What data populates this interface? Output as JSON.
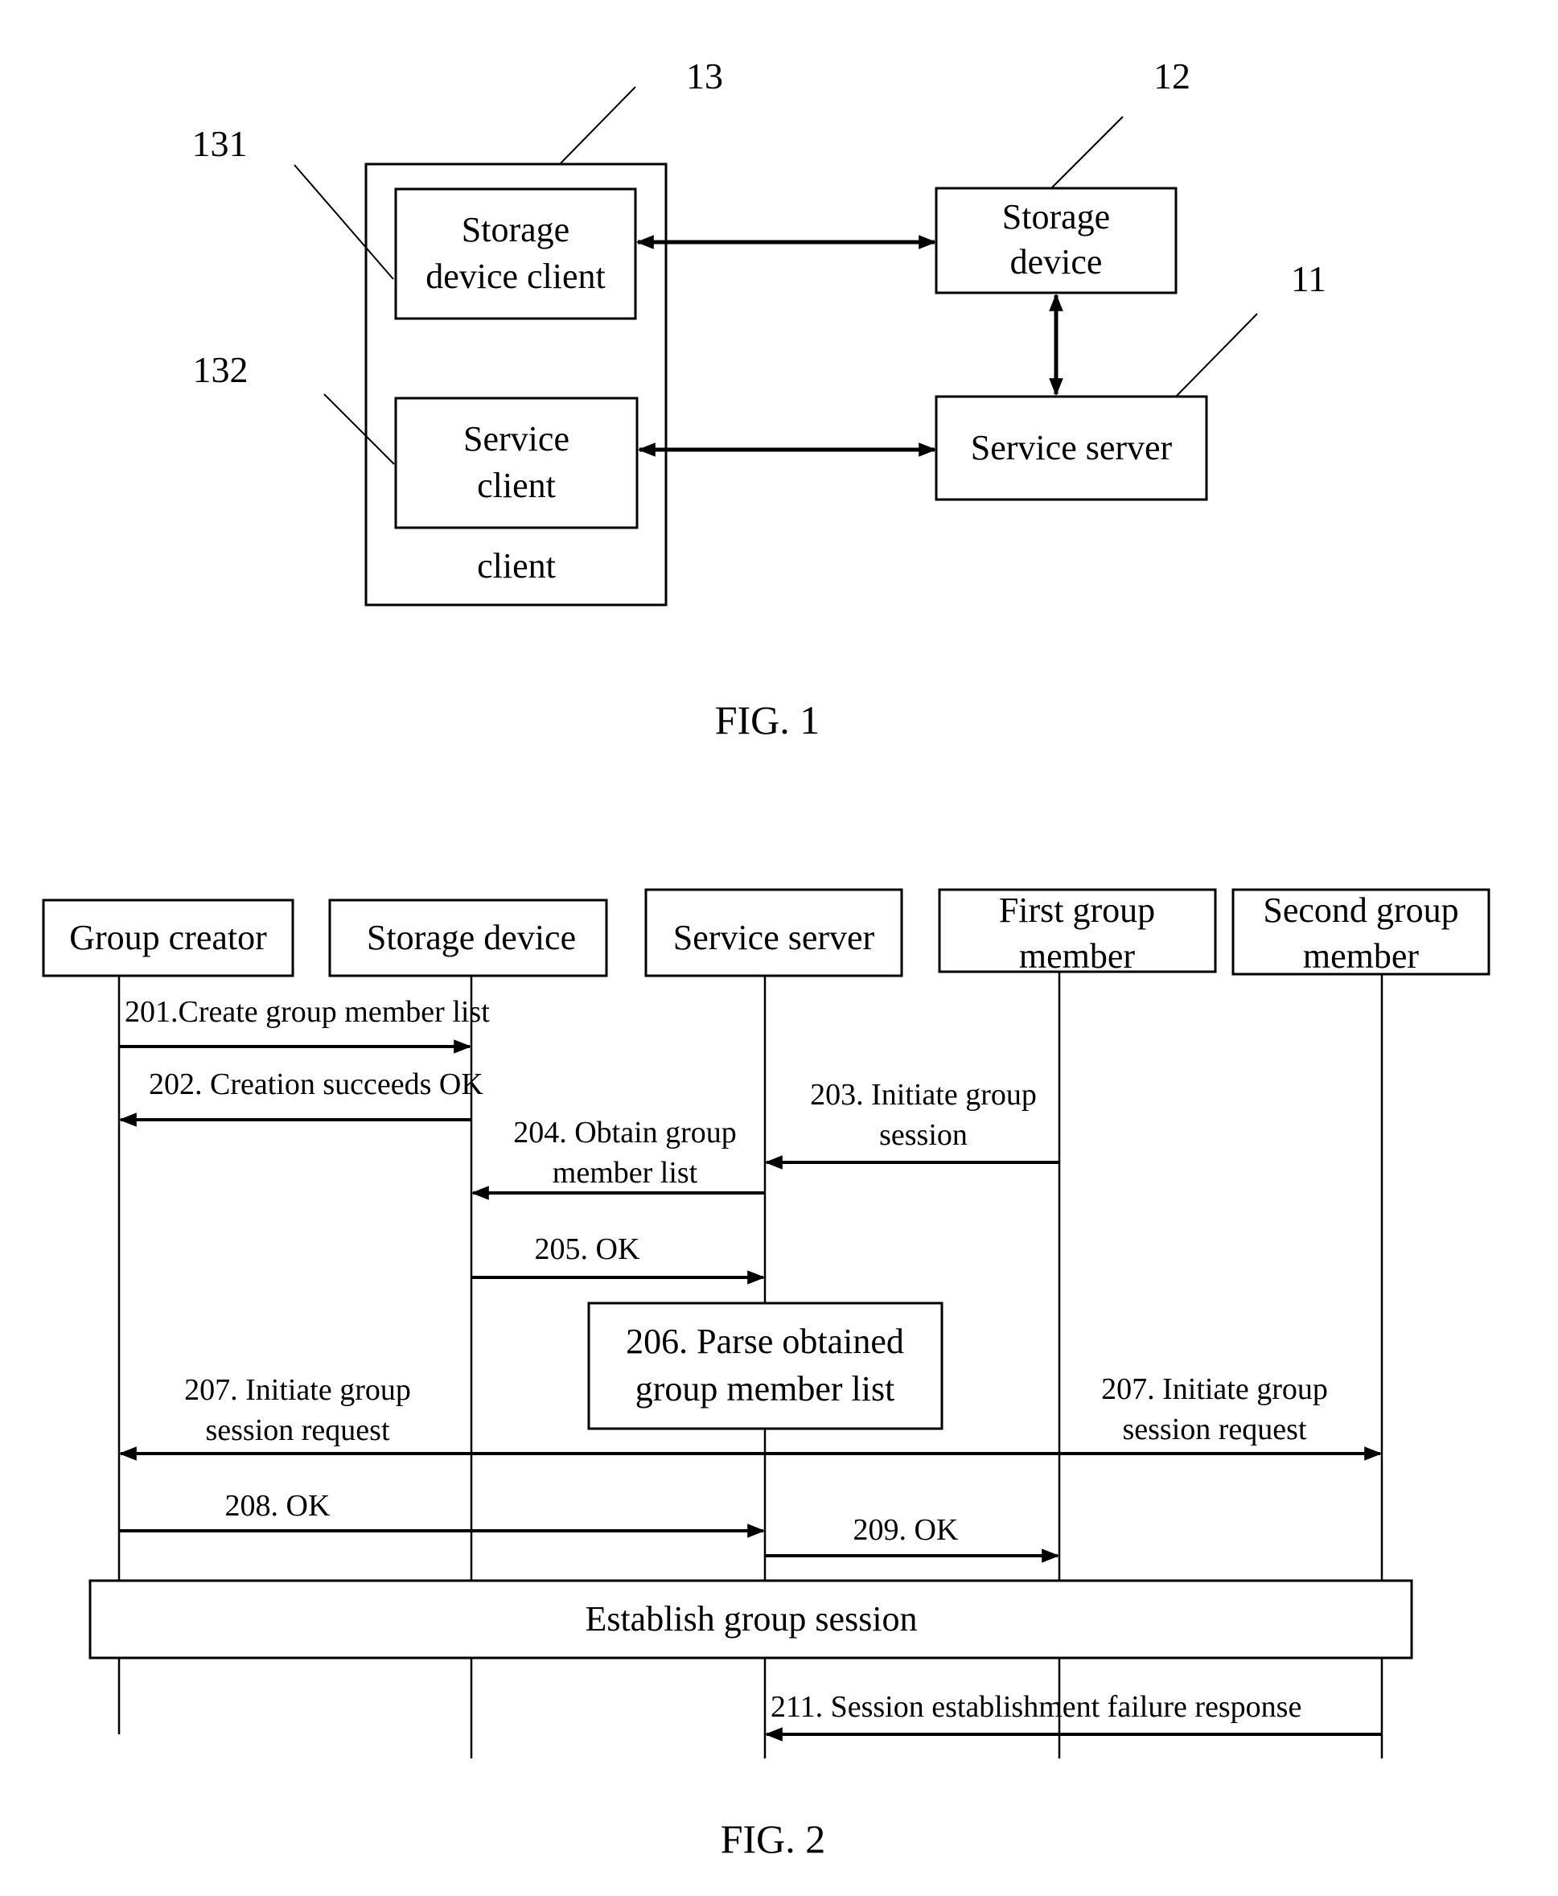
{
  "fig1": {
    "caption": "FIG. 1",
    "ref_labels": {
      "client_outer": "13",
      "storage_device": "12",
      "service_server": "11",
      "storage_device_client": "131",
      "service_client": "132"
    },
    "client_box": {
      "label": "client"
    },
    "storage_device_client": {
      "line1": "Storage",
      "line2": "device client"
    },
    "service_client": {
      "line1": "Service",
      "line2": "client"
    },
    "storage_device": {
      "line1": "Storage",
      "line2": "device"
    },
    "service_server": {
      "label": "Service server"
    },
    "connections": [
      {
        "from": "storage_device_client",
        "to": "storage_device",
        "type": "bidirectional"
      },
      {
        "from": "storage_device",
        "to": "service_server",
        "type": "bidirectional"
      },
      {
        "from": "service_client",
        "to": "service_server",
        "type": "bidirectional"
      }
    ]
  },
  "fig2": {
    "caption": "FIG. 2",
    "participants": [
      {
        "id": "group_creator",
        "line1": "Group creator",
        "line2": ""
      },
      {
        "id": "storage_device",
        "line1": "Storage device",
        "line2": ""
      },
      {
        "id": "service_server",
        "line1": "Service server",
        "line2": ""
      },
      {
        "id": "first_member",
        "line1": "First group",
        "line2": "member"
      },
      {
        "id": "second_member",
        "line1": "Second group",
        "line2": "member"
      }
    ],
    "messages": [
      {
        "step": "201",
        "line1": "201.Create group member list",
        "line2": "",
        "from": "group_creator",
        "to": "storage_device"
      },
      {
        "step": "202",
        "line1": "202. Creation succeeds OK",
        "line2": "",
        "from": "storage_device",
        "to": "group_creator"
      },
      {
        "step": "203",
        "line1": "203. Initiate group",
        "line2": "session",
        "from": "first_member",
        "to": "service_server"
      },
      {
        "step": "204",
        "line1": "204. Obtain group",
        "line2": "member list",
        "from": "service_server",
        "to": "storage_device"
      },
      {
        "step": "205",
        "line1": "205. OK",
        "line2": "",
        "from": "storage_device",
        "to": "service_server"
      },
      {
        "step": "207",
        "line1": "207. Initiate group",
        "line2": "session request",
        "from": "service_server",
        "to": "group_creator / second_member",
        "right_line1": "207. Initiate group",
        "right_line2": "session request"
      },
      {
        "step": "208",
        "line1": "208. OK",
        "line2": "",
        "from": "group_creator",
        "to": "service_server"
      },
      {
        "step": "209",
        "line1": "209. OK",
        "line2": "",
        "from": "service_server",
        "to": "first_member"
      },
      {
        "step": "211",
        "line1": "211. Session establishment failure response",
        "line2": "",
        "from": "second_member",
        "to": "service_server"
      }
    ],
    "process_box": {
      "line1": "206. Parse obtained",
      "line2": "group member list"
    },
    "establish_box": {
      "label": "Establish group session"
    }
  }
}
